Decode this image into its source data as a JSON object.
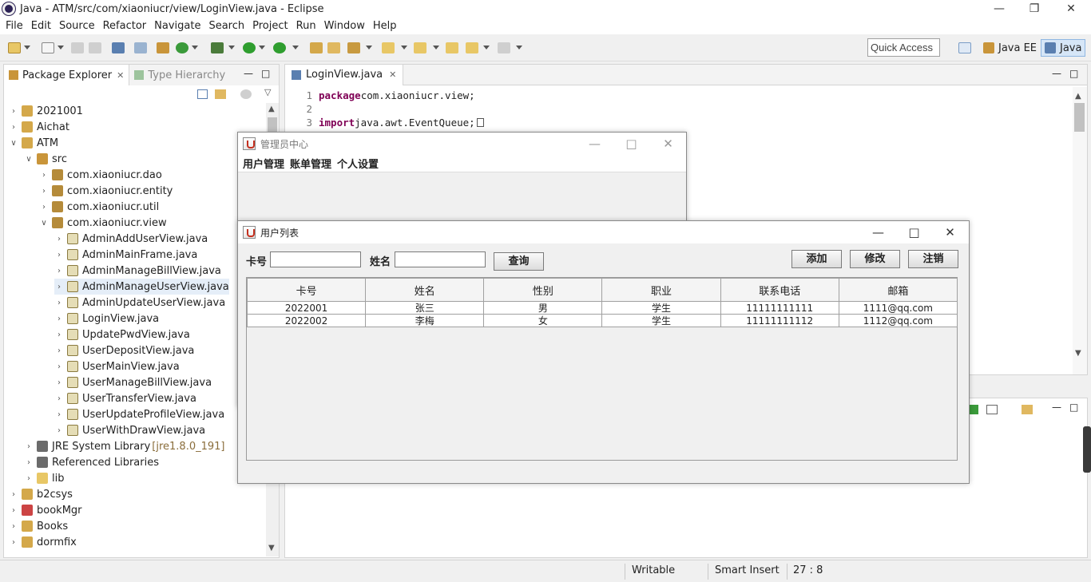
{
  "window": {
    "title": "Java - ATM/src/com/xiaoniucr/view/LoginView.java - Eclipse"
  },
  "menu": [
    "File",
    "Edit",
    "Source",
    "Refactor",
    "Navigate",
    "Search",
    "Project",
    "Run",
    "Window",
    "Help"
  ],
  "toolbar": {
    "quick_access": "Quick Access",
    "perspectives": [
      "Java EE",
      "Java"
    ]
  },
  "package_explorer": {
    "tabs": [
      "Package Explorer",
      "Type Hierarchy"
    ],
    "tree": [
      {
        "label": "2021001",
        "depth": 0,
        "expanded": false,
        "kind": "project"
      },
      {
        "label": "Aichat",
        "depth": 0,
        "expanded": false,
        "kind": "project"
      },
      {
        "label": "ATM",
        "depth": 0,
        "expanded": true,
        "kind": "project"
      },
      {
        "label": "src",
        "depth": 1,
        "expanded": true,
        "kind": "folder"
      },
      {
        "label": "com.xiaoniucr.dao",
        "depth": 2,
        "expanded": false,
        "kind": "package"
      },
      {
        "label": "com.xiaoniucr.entity",
        "depth": 2,
        "expanded": false,
        "kind": "package"
      },
      {
        "label": "com.xiaoniucr.util",
        "depth": 2,
        "expanded": false,
        "kind": "package"
      },
      {
        "label": "com.xiaoniucr.view",
        "depth": 2,
        "expanded": true,
        "kind": "package"
      },
      {
        "label": "AdminAddUserView.java",
        "depth": 3,
        "expanded": false,
        "kind": "java"
      },
      {
        "label": "AdminMainFrame.java",
        "depth": 3,
        "expanded": false,
        "kind": "java"
      },
      {
        "label": "AdminManageBillView.java",
        "depth": 3,
        "expanded": false,
        "kind": "java"
      },
      {
        "label": "AdminManageUserView.java",
        "depth": 3,
        "expanded": false,
        "kind": "java",
        "selected": true
      },
      {
        "label": "AdminUpdateUserView.java",
        "depth": 3,
        "expanded": false,
        "kind": "java"
      },
      {
        "label": "LoginView.java",
        "depth": 3,
        "expanded": false,
        "kind": "java"
      },
      {
        "label": "UpdatePwdView.java",
        "depth": 3,
        "expanded": false,
        "kind": "java"
      },
      {
        "label": "UserDepositView.java",
        "depth": 3,
        "expanded": false,
        "kind": "java"
      },
      {
        "label": "UserMainView.java",
        "depth": 3,
        "expanded": false,
        "kind": "java"
      },
      {
        "label": "UserManageBillView.java",
        "depth": 3,
        "expanded": false,
        "kind": "java"
      },
      {
        "label": "UserTransferView.java",
        "depth": 3,
        "expanded": false,
        "kind": "java"
      },
      {
        "label": "UserUpdateProfileView.java",
        "depth": 3,
        "expanded": false,
        "kind": "java"
      },
      {
        "label": "UserWithDrawView.java",
        "depth": 3,
        "expanded": false,
        "kind": "java"
      },
      {
        "label": "JRE System Library",
        "suffix": "[jre1.8.0_191]",
        "depth": 1,
        "expanded": false,
        "kind": "library"
      },
      {
        "label": "Referenced Libraries",
        "depth": 1,
        "expanded": false,
        "kind": "library"
      },
      {
        "label": "lib",
        "depth": 1,
        "expanded": false,
        "kind": "folder-plain"
      },
      {
        "label": "b2csys",
        "depth": 0,
        "expanded": false,
        "kind": "project"
      },
      {
        "label": "bookMgr",
        "depth": 0,
        "expanded": false,
        "kind": "project-error"
      },
      {
        "label": "Books",
        "depth": 0,
        "expanded": false,
        "kind": "project"
      },
      {
        "label": "dormfix",
        "depth": 0,
        "expanded": false,
        "kind": "project"
      }
    ]
  },
  "editor": {
    "tab": "LoginView.java",
    "lines": [
      {
        "num": "1",
        "kw": "package",
        "rest": " com.xiaoniucr.view;"
      },
      {
        "num": "2",
        "kw": "",
        "rest": ""
      },
      {
        "num": "3",
        "kw": "import",
        "rest": " java.awt.EventQueue;"
      }
    ]
  },
  "status": {
    "writable": "Writable",
    "insert": "Smart Insert",
    "position": "27 : 8"
  },
  "admin_window": {
    "title": "管理员中心",
    "menu": [
      "用户管理",
      "账单管理",
      "个人设置"
    ]
  },
  "user_list_window": {
    "title": "用户列表",
    "card_label": "卡号",
    "name_label": "姓名",
    "card_value": "",
    "name_value": "",
    "query_button": "查询",
    "add_button": "添加",
    "edit_button": "修改",
    "logout_button": "注销",
    "columns": [
      "卡号",
      "姓名",
      "性别",
      "职业",
      "联系电话",
      "邮箱"
    ],
    "rows": [
      [
        "2022001",
        "张三",
        "男",
        "学生",
        "11111111111",
        "1111@qq.com"
      ],
      [
        "2022002",
        "李梅",
        "女",
        "学生",
        "11111111112",
        "1112@qq.com"
      ]
    ]
  },
  "colors": {
    "keyword": "#7f0055",
    "selection": "#e5eef8",
    "current_line": "#e8f2fe"
  }
}
